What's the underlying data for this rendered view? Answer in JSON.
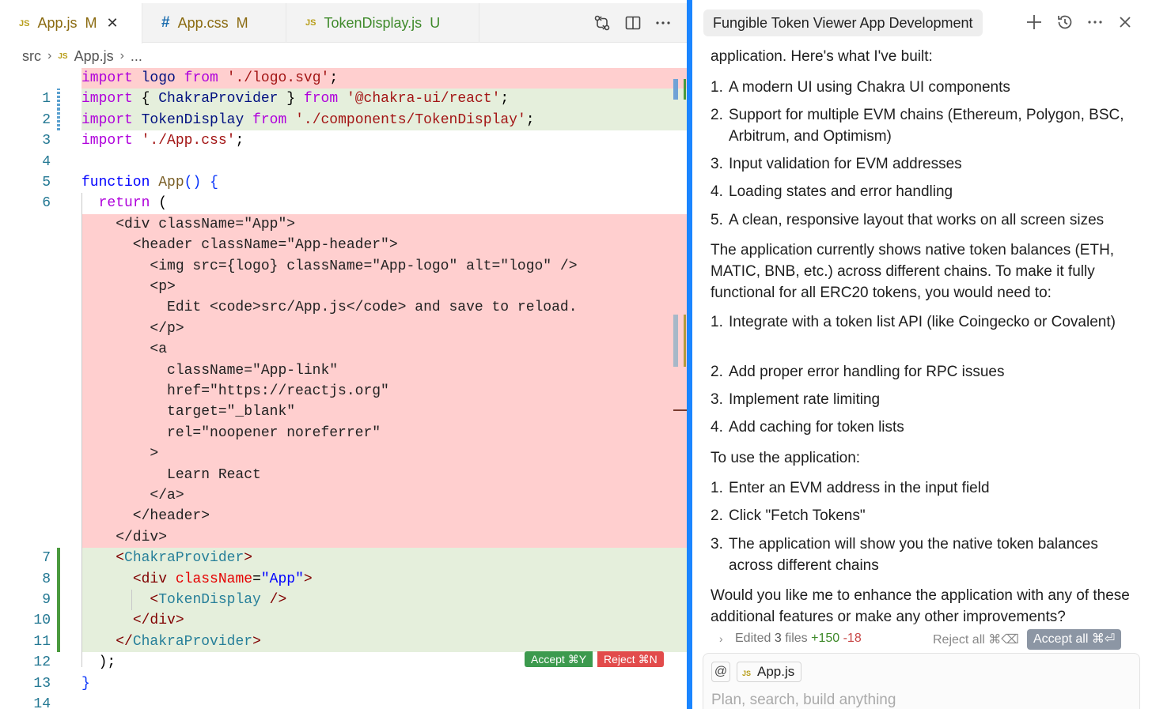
{
  "editor": {
    "tabs": [
      {
        "icon": "JS",
        "name": "App.js",
        "status": "M",
        "close": "✕"
      },
      {
        "icon": "#",
        "name": "App.css",
        "status": "M"
      },
      {
        "icon": "JS",
        "name": "TokenDisplay.js",
        "status": "U"
      }
    ],
    "breadcrumb": {
      "folder": "src",
      "file_icon": "JS",
      "file": "App.js",
      "more": "..."
    },
    "diff_actions": {
      "accept": "Accept ⌘Y",
      "reject": "Reject ⌘N"
    }
  },
  "chat": {
    "title": "Fungible Token Viewer App Development",
    "body": {
      "intro": "application. Here's what I've built:",
      "built": [
        {
          "n": "1.",
          "text": "A modern UI using Chakra UI components"
        },
        {
          "n": "2.",
          "text": "Support for multiple EVM chains (Ethereum, Polygon, BSC, Arbitrum, and Optimism)"
        },
        {
          "n": "3.",
          "text": "Input validation for EVM addresses"
        },
        {
          "n": "4.",
          "text": "Loading states and error handling"
        },
        {
          "n": "5.",
          "text": "A clean, responsive layout that works on all screen sizes"
        }
      ],
      "para2": "The application currently shows native token balances (ETH, MATIC, BNB, etc.) across different chains. To make it fully functional for all ERC20 tokens, you would need to:",
      "needs": [
        {
          "n": "1.",
          "text": "Integrate with a token list API (like Coingecko or Covalent)"
        },
        {
          "n": "2.",
          "text": "Add proper error handling for RPC issues"
        },
        {
          "n": "3.",
          "text": "Implement rate limiting"
        },
        {
          "n": "4.",
          "text": "Add caching for token lists"
        }
      ],
      "para3": "To use the application:",
      "steps": [
        {
          "n": "1.",
          "text": "Enter an EVM address in the input field"
        },
        {
          "n": "2.",
          "text": "Click \"Fetch Tokens\""
        },
        {
          "n": "3.",
          "text": "The application will show you the native token balances across different chains"
        }
      ],
      "para4": "Would you like me to enhance the application with any of these additional features or make any other improvements?"
    },
    "edited": {
      "prefix": "Edited",
      "count": "3",
      "files_label": "files",
      "added": "+150",
      "removed": "-18",
      "reject_all": "Reject all ⌘⌫",
      "accept_all": "Accept all ⌘⏎"
    },
    "composer": {
      "at": "@",
      "context_icon": "JS",
      "context_file": "App.js",
      "placeholder": "Plan, search, build anything"
    }
  }
}
